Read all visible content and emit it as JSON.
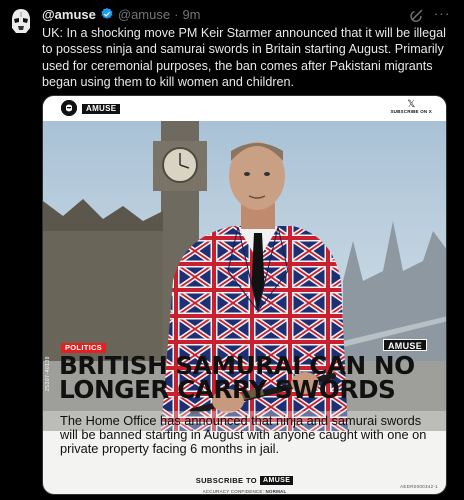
{
  "tweet": {
    "display_name": "@amuse",
    "handle": "@amuse",
    "separator": "·",
    "time": "9m",
    "text": "UK: In a shocking move PM Keir Starmer announced that it will be illegal to possess ninja and samurai swords in Britain starting August. Primarily used for ceremonial purposes, the ban comes after Pakistani migrants began using them to kill women and children.",
    "more_icon_glyph": "···"
  },
  "card": {
    "brand": "AMUSE",
    "subscribe_top_x": "𝕏",
    "subscribe_top_text": "SUBSCRIBE ON X",
    "vertical_code": "25307-40138",
    "watermark": "AMUSE",
    "category": "POLITICS",
    "headline": "BRITISH SAMURAI CAN NO LONGER CARRY SWORDS",
    "body": "The Home Office has announced that ninja and samurai swords will be banned starting in August with anyone caught with one on private property facing 6 months in jail.",
    "subscribe_label": "SUBSCRIBE TO",
    "subscribe_brand": "AMUSE",
    "confidence_label": "ACCURACY CONFIDENCE:",
    "confidence_value": "NORMAL",
    "ref_code": "AEDR0000342-1"
  },
  "colors": {
    "background": "#000000",
    "text": "#e7e9ea",
    "muted": "#71767b",
    "verified_blue": "#1d9bf0",
    "badge_red": "#e52020"
  }
}
